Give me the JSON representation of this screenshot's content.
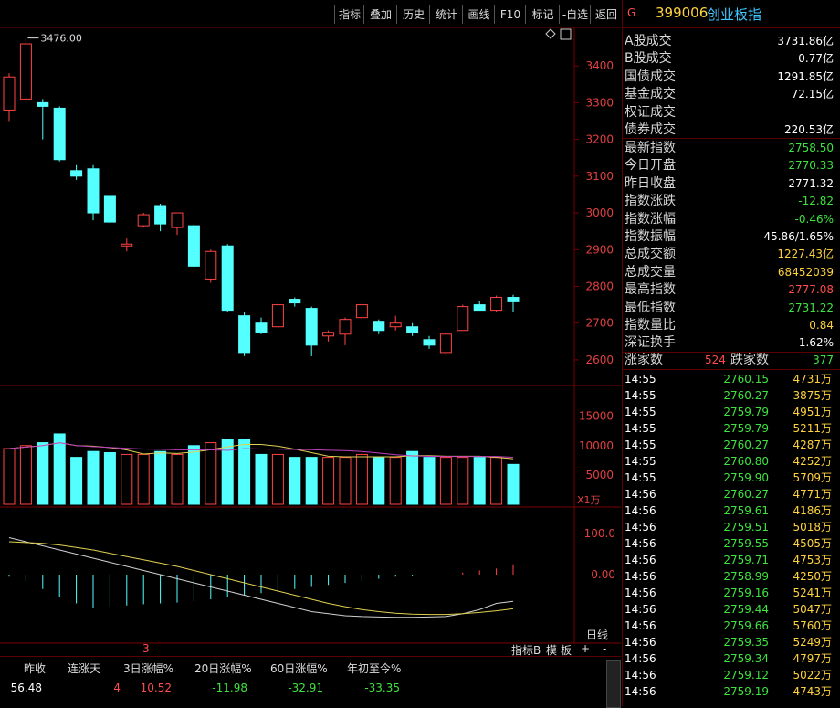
{
  "toolbar": {
    "buttons": [
      "指标",
      "叠加",
      "历史",
      "统计",
      "画线",
      "F10",
      "标记",
      "-自选",
      "返回"
    ]
  },
  "header": {
    "flag": "G",
    "code": "399006",
    "name": "创业板指"
  },
  "summary": [
    {
      "label": "A股成交",
      "value": "3731.86亿",
      "color": "white"
    },
    {
      "label": "B股成交",
      "value": "0.77亿",
      "color": "white"
    },
    {
      "label": "国债成交",
      "value": "1291.85亿",
      "color": "white"
    },
    {
      "label": "基金成交",
      "value": "72.15亿",
      "color": "white"
    },
    {
      "label": "权证成交",
      "value": "",
      "color": "white"
    },
    {
      "label": "债券成交",
      "value": "220.53亿",
      "color": "white"
    }
  ],
  "index_stats": [
    {
      "label": "最新指数",
      "value": "2758.50",
      "color": "green"
    },
    {
      "label": "今日开盘",
      "value": "2770.33",
      "color": "green"
    },
    {
      "label": "昨日收盘",
      "value": "2771.32",
      "color": "white"
    },
    {
      "label": "指数涨跌",
      "value": "-12.82",
      "color": "green"
    },
    {
      "label": "指数涨幅",
      "value": "-0.46%",
      "color": "green"
    },
    {
      "label": "指数振幅",
      "value": "45.86/1.65%",
      "color": "white"
    },
    {
      "label": "总成交额",
      "value": "1227.43亿",
      "color": "yellow"
    },
    {
      "label": "总成交量",
      "value": "68452039",
      "color": "yellow"
    },
    {
      "label": "最高指数",
      "value": "2777.08",
      "color": "red"
    },
    {
      "label": "最低指数",
      "value": "2731.22",
      "color": "green"
    },
    {
      "label": "指数量比",
      "value": "0.84",
      "color": "yellow"
    },
    {
      "label": "深证换手",
      "value": "1.62%",
      "color": "white"
    }
  ],
  "breadth": {
    "up_label": "涨家数",
    "up": "524",
    "down_label": "跌家数",
    "down": "377"
  },
  "ticks": [
    {
      "t": "14:55",
      "p": "2760.15",
      "v": "4731万",
      "c": "green"
    },
    {
      "t": "14:55",
      "p": "2760.27",
      "v": "3875万",
      "c": "green"
    },
    {
      "t": "14:55",
      "p": "2759.79",
      "v": "4951万",
      "c": "green"
    },
    {
      "t": "14:55",
      "p": "2759.79",
      "v": "5211万",
      "c": "green"
    },
    {
      "t": "14:55",
      "p": "2760.27",
      "v": "4287万",
      "c": "green"
    },
    {
      "t": "14:55",
      "p": "2760.80",
      "v": "4252万",
      "c": "green"
    },
    {
      "t": "14:55",
      "p": "2759.90",
      "v": "5709万",
      "c": "green"
    },
    {
      "t": "14:56",
      "p": "2760.27",
      "v": "4771万",
      "c": "green"
    },
    {
      "t": "14:56",
      "p": "2759.61",
      "v": "4186万",
      "c": "green"
    },
    {
      "t": "14:56",
      "p": "2759.51",
      "v": "5018万",
      "c": "green"
    },
    {
      "t": "14:56",
      "p": "2759.55",
      "v": "4505万",
      "c": "green"
    },
    {
      "t": "14:56",
      "p": "2759.71",
      "v": "4753万",
      "c": "green"
    },
    {
      "t": "14:56",
      "p": "2758.99",
      "v": "4250万",
      "c": "green"
    },
    {
      "t": "14:56",
      "p": "2759.16",
      "v": "5241万",
      "c": "green"
    },
    {
      "t": "14:56",
      "p": "2759.44",
      "v": "5047万",
      "c": "green"
    },
    {
      "t": "14:56",
      "p": "2759.66",
      "v": "5760万",
      "c": "green"
    },
    {
      "t": "14:56",
      "p": "2759.35",
      "v": "5249万",
      "c": "green"
    },
    {
      "t": "14:56",
      "p": "2759.34",
      "v": "4797万",
      "c": "green"
    },
    {
      "t": "14:56",
      "p": "2759.12",
      "v": "5022万",
      "c": "green"
    },
    {
      "t": "14:56",
      "p": "2759.19",
      "v": "4743万",
      "c": "green"
    }
  ],
  "chart_data": {
    "type": "candlestick",
    "high_label": "3476.00",
    "price_axis": {
      "ticks": [
        "3400",
        "3300",
        "3200",
        "3100",
        "3000",
        "2900",
        "2800",
        "2700",
        "2600"
      ],
      "range": [
        2560,
        3480
      ]
    },
    "volume_axis": {
      "ticks": [
        "15000",
        "10000",
        "5000"
      ],
      "unit": "X1万",
      "range": [
        0,
        19000
      ]
    },
    "macd_axis": {
      "ticks": [
        "100.0",
        "0.00"
      ]
    },
    "period_label": "日线",
    "footer_tabs": [
      "3",
      "指标B",
      "模",
      "板",
      "+",
      "-"
    ],
    "candles": [
      {
        "o": 3280,
        "h": 3380,
        "l": 3250,
        "c": 3370
      },
      {
        "o": 3310,
        "h": 3476,
        "l": 3300,
        "c": 3460
      },
      {
        "o": 3300,
        "h": 3310,
        "l": 3200,
        "c": 3290
      },
      {
        "o": 3285,
        "h": 3290,
        "l": 3140,
        "c": 3145
      },
      {
        "o": 3115,
        "h": 3130,
        "l": 3090,
        "c": 3100
      },
      {
        "o": 3120,
        "h": 3130,
        "l": 2980,
        "c": 3000
      },
      {
        "o": 3045,
        "h": 3050,
        "l": 2970,
        "c": 2975
      },
      {
        "o": 2910,
        "h": 2930,
        "l": 2895,
        "c": 2915
      },
      {
        "o": 2965,
        "h": 3000,
        "l": 2960,
        "c": 2995
      },
      {
        "o": 3020,
        "h": 3025,
        "l": 2950,
        "c": 2970
      },
      {
        "o": 2960,
        "h": 3000,
        "l": 2940,
        "c": 3000
      },
      {
        "o": 2965,
        "h": 2970,
        "l": 2850,
        "c": 2855
      },
      {
        "o": 2820,
        "h": 2900,
        "l": 2810,
        "c": 2895
      },
      {
        "o": 2910,
        "h": 2915,
        "l": 2730,
        "c": 2735
      },
      {
        "o": 2720,
        "h": 2730,
        "l": 2610,
        "c": 2620
      },
      {
        "o": 2700,
        "h": 2715,
        "l": 2670,
        "c": 2675
      },
      {
        "o": 2690,
        "h": 2755,
        "l": 2690,
        "c": 2750
      },
      {
        "o": 2765,
        "h": 2770,
        "l": 2745,
        "c": 2755
      },
      {
        "o": 2740,
        "h": 2745,
        "l": 2610,
        "c": 2640
      },
      {
        "o": 2665,
        "h": 2680,
        "l": 2650,
        "c": 2675
      },
      {
        "o": 2670,
        "h": 2715,
        "l": 2640,
        "c": 2710
      },
      {
        "o": 2715,
        "h": 2755,
        "l": 2710,
        "c": 2750
      },
      {
        "o": 2705,
        "h": 2710,
        "l": 2670,
        "c": 2680
      },
      {
        "o": 2690,
        "h": 2720,
        "l": 2680,
        "c": 2700
      },
      {
        "o": 2690,
        "h": 2700,
        "l": 2665,
        "c": 2675
      },
      {
        "o": 2655,
        "h": 2665,
        "l": 2630,
        "c": 2640
      },
      {
        "o": 2620,
        "h": 2675,
        "l": 2610,
        "c": 2670
      },
      {
        "o": 2680,
        "h": 2750,
        "l": 2680,
        "c": 2745
      },
      {
        "o": 2750,
        "h": 2760,
        "l": 2735,
        "c": 2735
      },
      {
        "o": 2735,
        "h": 2775,
        "l": 2730,
        "c": 2770
      },
      {
        "o": 2770,
        "h": 2777,
        "l": 2731,
        "c": 2758
      }
    ],
    "volume": [
      9500,
      10000,
      10500,
      12000,
      8000,
      9000,
      8800,
      8500,
      8500,
      9000,
      8500,
      10000,
      10500,
      11000,
      11000,
      8500,
      8500,
      8000,
      8000,
      8000,
      8000,
      8500,
      8000,
      8000,
      9000,
      8000,
      8000,
      8000,
      8000,
      8000,
      6800
    ],
    "macd": [
      -5,
      -15,
      -35,
      -55,
      -70,
      -80,
      -78,
      -75,
      -72,
      -70,
      -68,
      -65,
      -60,
      -55,
      -50,
      -45,
      -40,
      -35,
      -30,
      -25,
      -20,
      -15,
      -10,
      -5,
      -2,
      0,
      2,
      5,
      10,
      15,
      25
    ],
    "dif": [
      90,
      80,
      70,
      60,
      50,
      40,
      30,
      20,
      10,
      0,
      -10,
      -20,
      -30,
      -40,
      -50,
      -60,
      -70,
      -80,
      -90,
      -95,
      -100,
      -102,
      -103,
      -104,
      -104,
      -103,
      -102,
      -95,
      -85,
      -70,
      -65
    ],
    "dea": [
      80,
      78,
      76,
      72,
      66,
      60,
      52,
      44,
      36,
      28,
      20,
      10,
      0,
      -10,
      -20,
      -30,
      -40,
      -50,
      -60,
      -70,
      -78,
      -85,
      -90,
      -94,
      -96,
      -97,
      -97,
      -95,
      -92,
      -88,
      -83
    ]
  },
  "stats_header": [
    "昨收",
    "连涨天",
    "3日涨幅%",
    "20日涨幅%",
    "60日涨幅%",
    "年初至今%"
  ],
  "stats_values": [
    {
      "v": "56.48",
      "c": "white"
    },
    {
      "v": "4",
      "c": "red"
    },
    {
      "v": "10.52",
      "c": "red"
    },
    {
      "v": "-11.98",
      "c": "green"
    },
    {
      "v": "-32.91",
      "c": "green"
    },
    {
      "v": "-33.35",
      "c": "green"
    }
  ]
}
